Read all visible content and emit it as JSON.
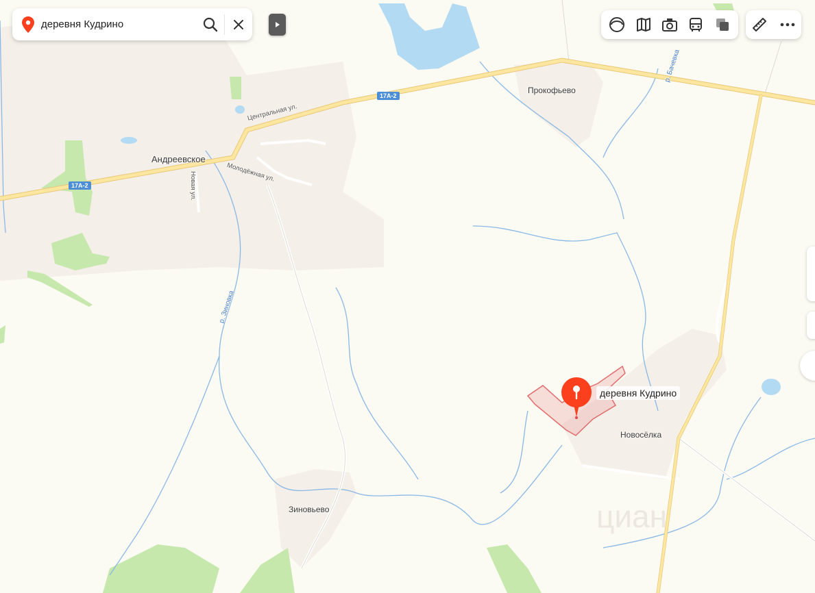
{
  "search": {
    "query": "деревня Кудрино"
  },
  "colors": {
    "pin": "#fc3f1d",
    "water": "#b3daf3",
    "road": "#fde6a0",
    "forest": "#c7e8ad",
    "settlement": "#f4efe8",
    "river": "#8ab8e6",
    "area_outline": "#e06c6c",
    "area_fill": "rgba(231,120,120,0.22)"
  },
  "places": {
    "andreevskoe": "Андреевское",
    "prokofevo": "Прокофьево",
    "zinovevo": "Зиновьево",
    "novoselka": "Новосёлка"
  },
  "streets": {
    "centralnaya": "Центральная ул.",
    "molodezhnaya": "Молодёжная ул.",
    "novaya": "Новая ул."
  },
  "rivers": {
    "zinovka": "р. Зиновка",
    "bachevka": "р. Бачевка"
  },
  "road_shields": {
    "west": "17А-2",
    "center": "17А-2"
  },
  "pin": {
    "label": "деревня Кудрино"
  },
  "icons": {
    "search_bar": [
      "location-pin-icon",
      "search-icon",
      "close-icon"
    ],
    "collapse": "play-arrow-icon",
    "layers": [
      "panorama-circle-icon",
      "map-layers-icon",
      "camera-photo-icon",
      "bus-transit-icon",
      "map-type-icon"
    ],
    "tools": [
      "ruler-icon",
      "more-dots-icon"
    ]
  }
}
